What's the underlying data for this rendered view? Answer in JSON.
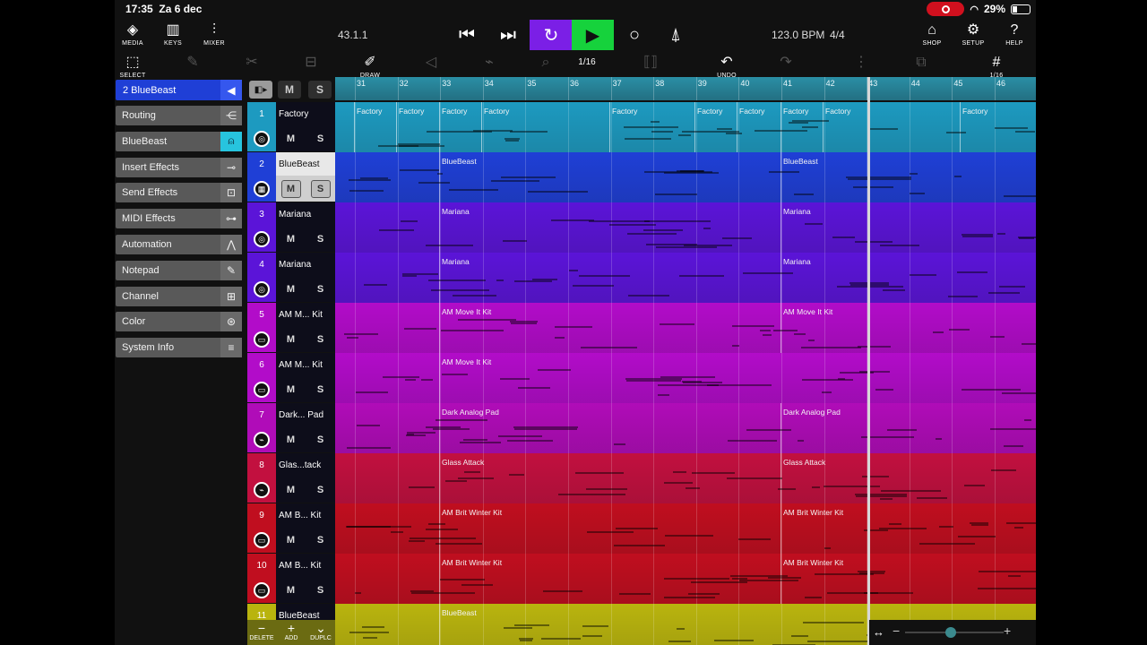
{
  "status": {
    "time": "17:35",
    "date": "Za 6 dec",
    "battery": "29%"
  },
  "toolbar": {
    "media": "MEDIA",
    "keys": "KEYS",
    "mixer": "MIXER",
    "position": "43.1.1",
    "tempo": "123.0 BPM",
    "signature": "4/4",
    "shop": "SHOP",
    "setup": "SETUP",
    "help": "HELP"
  },
  "toolbar2": {
    "select": "SELECT",
    "draw": "DRAW",
    "quantize": "1/16",
    "undo": "UNDO",
    "grid": "1/16"
  },
  "inspector": {
    "header": "2  BlueBeast",
    "items": [
      {
        "label": "Routing",
        "icon": "routing-icon"
      },
      {
        "label": "BlueBeast",
        "icon": "instrument-icon"
      },
      {
        "label": "Insert Effects",
        "icon": "insert-effects-icon"
      },
      {
        "label": "Send Effects",
        "icon": "send-effects-icon"
      },
      {
        "label": "MIDI Effects",
        "icon": "midi-effects-icon"
      },
      {
        "label": "Automation",
        "icon": "automation-icon"
      },
      {
        "label": "Notepad",
        "icon": "notepad-icon"
      },
      {
        "label": "Channel",
        "icon": "channel-icon"
      },
      {
        "label": "Color",
        "icon": "color-icon"
      },
      {
        "label": "System Info",
        "icon": "system-info-icon"
      }
    ]
  },
  "mute_label": "M",
  "solo_label": "S",
  "ruler": {
    "bars": [
      "31",
      "32",
      "33",
      "34",
      "35",
      "36",
      "37",
      "38",
      "39",
      "40",
      "41",
      "42",
      "43",
      "44",
      "45",
      "46"
    ]
  },
  "tracks": [
    {
      "num": "1",
      "name": "Factory",
      "color": "#1d9ac0",
      "numcolor": "#1d9ac0",
      "clips": [
        "Factory",
        "Factory",
        "Factory",
        "Factory",
        "Factory",
        "Factory",
        "Factory",
        "Factory",
        "Factory",
        "Factory"
      ]
    },
    {
      "num": "2",
      "name": "BlueBeast",
      "color": "#1f3fd6",
      "numcolor": "#1f3fd6",
      "clips": [
        "BlueBeast",
        "BlueBeast"
      ]
    },
    {
      "num": "3",
      "name": "Mariana",
      "color": "#5b14d8",
      "numcolor": "#5b14d8",
      "clips": [
        "Mariana",
        "Mariana"
      ]
    },
    {
      "num": "4",
      "name": "Mariana",
      "color": "#5b14d8",
      "numcolor": "#5b14d8",
      "clips": [
        "Mariana",
        "Mariana"
      ]
    },
    {
      "num": "5",
      "name": "AM M... Kit",
      "color": "#b20cc9",
      "numcolor": "#b20cc9",
      "clips": [
        "AM Move It Kit",
        "AM Move It Kit"
      ]
    },
    {
      "num": "6",
      "name": "AM M... Kit",
      "color": "#b20cc9",
      "numcolor": "#b20cc9",
      "clips": [
        "AM Move It Kit"
      ]
    },
    {
      "num": "7",
      "name": "Dark... Pad",
      "color": "#b00cb8",
      "numcolor": "#b00cb8",
      "clips": [
        "Dark Analog Pad",
        "Dark Analog Pad"
      ]
    },
    {
      "num": "8",
      "name": "Glas...tack",
      "color": "#c2103f",
      "numcolor": "#c2103f",
      "clips": [
        "Glass Attack",
        "Glass Attack"
      ]
    },
    {
      "num": "9",
      "name": "AM B... Kit",
      "color": "#c00e1f",
      "numcolor": "#c00e1f",
      "clips": [
        "AM Brit Winter Kit",
        "AM Brit Winter Kit"
      ]
    },
    {
      "num": "10",
      "name": "AM B... Kit",
      "color": "#c00e1f",
      "numcolor": "#c00e1f",
      "clips": [
        "AM Brit Winter Kit",
        "AM Brit Winter Kit"
      ]
    },
    {
      "num": "11",
      "name": "BlueBeast",
      "color": "#b9b40e",
      "numcolor": "#b9b40e",
      "clips": [
        "BlueBeast"
      ]
    }
  ],
  "bottom": {
    "delete": "DELETE",
    "add": "ADD",
    "duplicate": "DUPLC"
  }
}
